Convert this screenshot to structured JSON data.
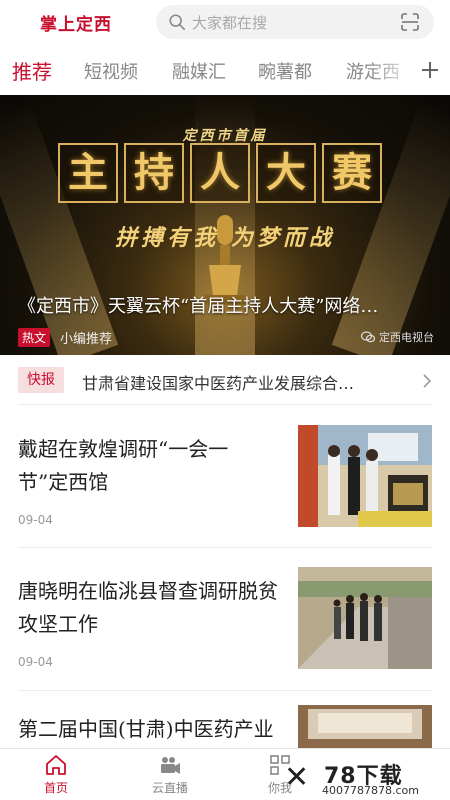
{
  "header": {
    "app_title": "掌上定西",
    "search_placeholder": "大家都在搜"
  },
  "tabs": [
    {
      "label": "推荐",
      "active": true
    },
    {
      "label": "短视频",
      "active": false
    },
    {
      "label": "融媒汇",
      "active": false
    },
    {
      "label": "畹薯都",
      "active": false
    },
    {
      "label": "游定西",
      "active": false
    }
  ],
  "banner": {
    "small_heading": "定西市首届",
    "big_title_chars": [
      "主",
      "持",
      "人",
      "大",
      "赛"
    ],
    "slogan": "拼搏有我  为梦而战",
    "caption": "《定西市》天翼云杯“首届主持人大赛”网络…",
    "hot_badge": "热文",
    "editor_pick": "小编推荐",
    "source": "定西电视台"
  },
  "flash_news": {
    "badge": "快报",
    "text": "甘肃省建设国家中医药产业发展综合…"
  },
  "news": [
    {
      "title": "戴超在敦煌调研“一会一节”定西馆",
      "date": "09-04",
      "thumb": "exhibit-hall-photo"
    },
    {
      "title": "唐晓明在临洮县督查调研脱贫攻坚工作",
      "date": "09-04",
      "thumb": "field-inspection-photo"
    },
    {
      "title": "第二届中国(甘肃)中医药产业",
      "date": "",
      "thumb": "conference-room-photo"
    }
  ],
  "bottom_nav": [
    {
      "label": "首页",
      "icon": "home-icon",
      "active": true
    },
    {
      "label": "云直播",
      "icon": "live-camera-icon",
      "active": false
    },
    {
      "label": "你我",
      "icon": "grid-icon",
      "active": false
    }
  ],
  "watermark": {
    "brand": "78下载",
    "url": "4007787878.com"
  },
  "colors": {
    "accent": "#c8102e",
    "flash_badge_bg": "#f7dede",
    "muted_text": "#888888"
  }
}
